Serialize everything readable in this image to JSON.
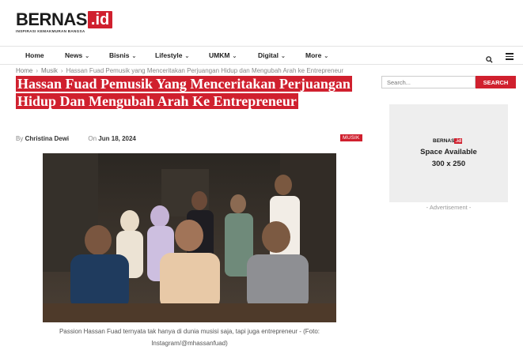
{
  "header": {
    "logo_text": "BERNAS",
    "logo_badge": ".id",
    "logo_tagline": "INSPIRASI KEMAKMURAN BANGSA"
  },
  "nav": {
    "items": [
      {
        "label": "Home",
        "has_caret": false
      },
      {
        "label": "News",
        "has_caret": true
      },
      {
        "label": "Bisnis",
        "has_caret": true
      },
      {
        "label": "Lifestyle",
        "has_caret": true
      },
      {
        "label": "UMKM",
        "has_caret": true
      },
      {
        "label": "Digital",
        "has_caret": true
      },
      {
        "label": "More",
        "has_caret": true
      }
    ],
    "search_icon": "search-icon",
    "menu_icon": "hamburger-menu-icon"
  },
  "breadcrumb": {
    "items": [
      "Home",
      "Musik",
      "Hassan Fuad Pemusik yang Menceritakan Perjuangan Hidup dan Mengubah Arah ke Entrepreneur"
    ]
  },
  "article": {
    "title": "Hassan Fuad Pemusik Yang Menceritakan Perjuangan Hidup Dan Mengubah Arah Ke Entrepreneur",
    "by_label": "By",
    "author": "Christina Dewi",
    "on_label": "On",
    "date": "Jun 18, 2024",
    "category": "MUSIK",
    "caption": "Passion Hassan Fuad ternyata tak hanya di dunia musisi saja, tapi juga entrepreneur - (Foto: Instagram/@mhassanfuad)"
  },
  "sidebar": {
    "search_placeholder": "Search...",
    "search_button": "SEARCH",
    "ad": {
      "logo_text": "BERNAS",
      "logo_badge": ".id",
      "line1": "Space Available",
      "line2": "300 x 250",
      "label": "- Advertisement -"
    }
  },
  "colors": {
    "brand_red": "#d0202e",
    "text_dark": "#222222"
  }
}
